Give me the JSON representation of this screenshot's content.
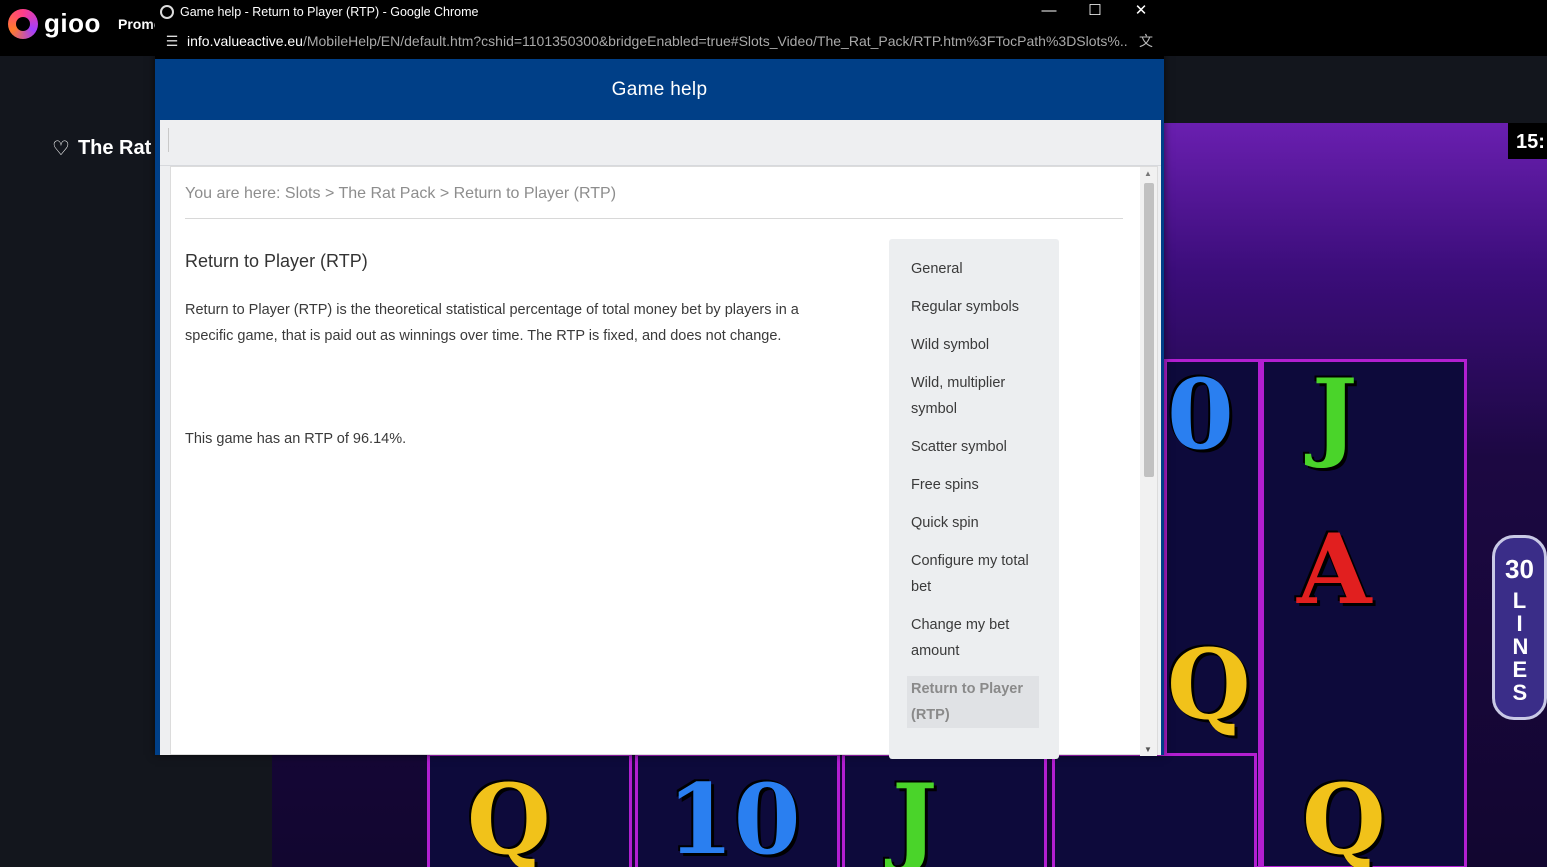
{
  "site": {
    "logo_text": "gioo",
    "nav_promo": "Promo",
    "game_title": "The Rat",
    "clock": "15:",
    "lines_number": "30",
    "lines_word": "LINES"
  },
  "window": {
    "title": "Game help - Return to Player (RTP) - Google Chrome",
    "url_host": "info.valueactive.eu",
    "url_path": "/MobileHelp/EN/default.htm?cshid=1101350300&bridgeEnabled=true#Slots_Video/The_Rat_Pack/RTP.htm%3FTocPath%3DSlots%..."
  },
  "help": {
    "header_title": "Game help",
    "breadcrumb": "You are here: Slots > The Rat Pack > Return to Player (RTP)",
    "page_title": "Return to Player (RTP)",
    "description": "Return to Player (RTP) is the theoretical statistical percentage of total money bet by players in a specific game, that is paid out as winnings over time. The RTP is fixed, and does not change.",
    "rtp_statement": "This game has an RTP of 96.14%.",
    "toc": [
      "General",
      "Regular symbols",
      "Wild symbol",
      "Wild, multiplier symbol",
      "Scatter symbol",
      "Free spins",
      "Quick spin",
      "Configure my total bet",
      "Change my bet amount",
      "Return to Player (RTP)"
    ],
    "active_toc_index": 9
  },
  "icons": {
    "favorite": "heart-icon",
    "site_info": "tune-icon",
    "translate": "translate-icon",
    "minimize": "minimize-icon",
    "maximize": "maximize-icon",
    "close": "close-icon"
  },
  "colors": {
    "help_header": "#003f87",
    "reel_border": "#b21fd1"
  }
}
